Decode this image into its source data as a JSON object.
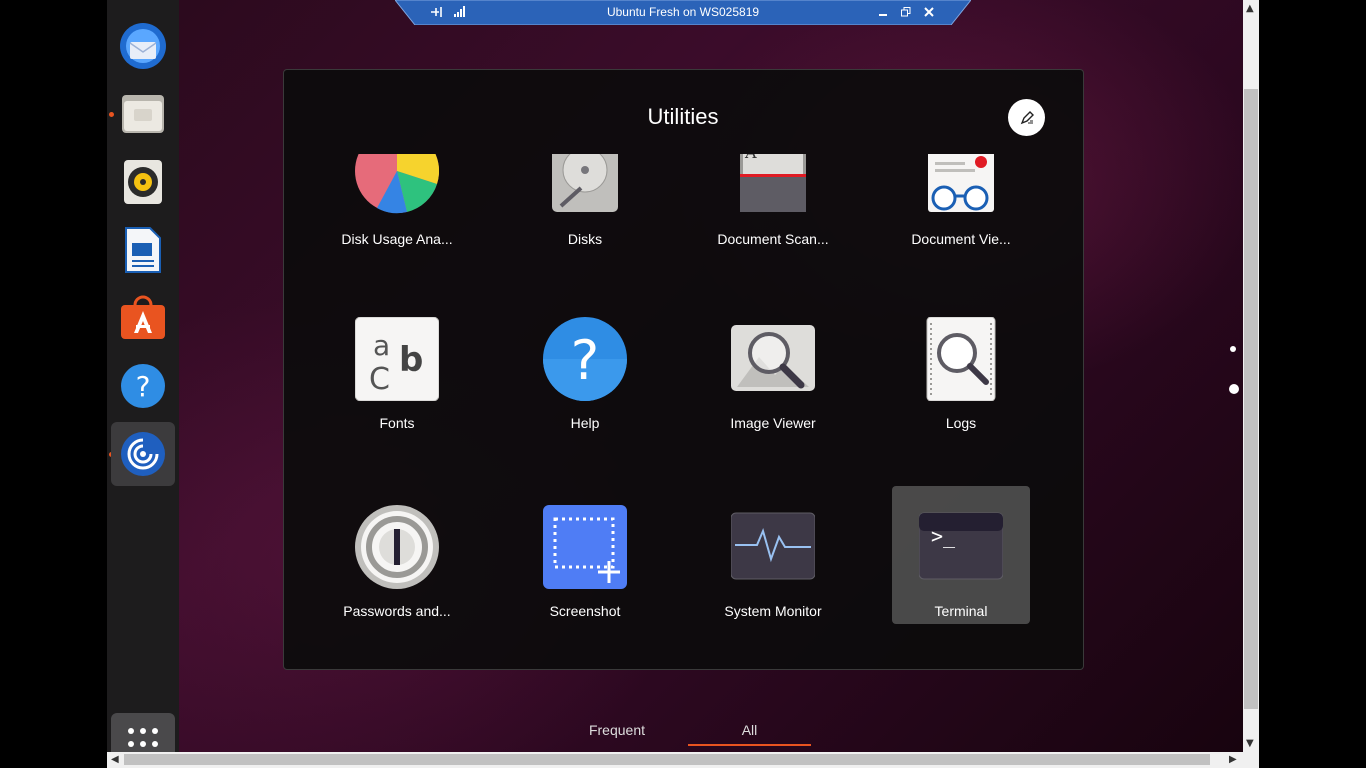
{
  "remote_window": {
    "title": "Ubuntu Fresh on WS025819"
  },
  "dock": {
    "items": [
      {
        "name": "thunderbird"
      },
      {
        "name": "files",
        "running": true
      },
      {
        "name": "rhythmbox"
      },
      {
        "name": "libreoffice-impress"
      },
      {
        "name": "ubuntu-software"
      },
      {
        "name": "help"
      },
      {
        "name": "remmina",
        "running": true,
        "active": true
      }
    ],
    "show_apps_label": "Show Applications"
  },
  "folder": {
    "title": "Utilities",
    "apps": [
      {
        "label": "Disk Usage Ana...",
        "icon": "disk-usage-icon"
      },
      {
        "label": "Disks",
        "icon": "disks-icon"
      },
      {
        "label": "Document Scan...",
        "icon": "document-scanner-icon"
      },
      {
        "label": "Document Vie...",
        "icon": "document-viewer-icon"
      },
      {
        "label": "Fonts",
        "icon": "fonts-icon"
      },
      {
        "label": "Help",
        "icon": "help-icon"
      },
      {
        "label": "Image Viewer",
        "icon": "image-viewer-icon"
      },
      {
        "label": "Logs",
        "icon": "logs-icon"
      },
      {
        "label": "Passwords and...",
        "icon": "passwords-icon"
      },
      {
        "label": "Screenshot",
        "icon": "screenshot-icon"
      },
      {
        "label": "System Monitor",
        "icon": "system-monitor-icon"
      },
      {
        "label": "Terminal",
        "icon": "terminal-icon",
        "selected": true
      }
    ]
  },
  "tabs": [
    {
      "label": "Frequent"
    },
    {
      "label": "All",
      "active": true
    }
  ],
  "colors": {
    "accent": "#e95420",
    "folder_bg": "#0c0c0c"
  }
}
